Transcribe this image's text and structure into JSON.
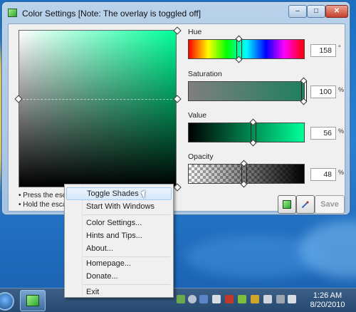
{
  "window": {
    "title": "Color Settings [Note: The overlay is toggled off]",
    "minimize": "–",
    "maximize": "□",
    "close": "✕"
  },
  "help_lines": [
    "• Press the escape",
    "• Hold the escape"
  ],
  "sliders": {
    "hue": {
      "label": "Hue",
      "value": "158",
      "unit": "°",
      "fraction": 0.44
    },
    "saturation": {
      "label": "Saturation",
      "value": "100",
      "unit": "%",
      "fraction": 1.0
    },
    "value": {
      "label": "Value",
      "value": "56",
      "unit": "%",
      "fraction": 0.56
    },
    "opacity": {
      "label": "Opacity",
      "value": "48",
      "unit": "%",
      "fraction": 0.48
    }
  },
  "buttons": {
    "save": "Save"
  },
  "icons": {
    "app": "monitor-icon",
    "toggle_overlay": "monitor-icon",
    "eyedropper": "eyedropper-icon"
  },
  "context_menu": {
    "items": [
      {
        "label": "Toggle Shades",
        "highlighted": true
      },
      {
        "label": "Start With Windows"
      },
      {
        "label": "Color Settings..."
      },
      {
        "label": "Hints and Tips..."
      },
      {
        "label": "About..."
      },
      {
        "label": "Homepage..."
      },
      {
        "label": "Donate..."
      },
      {
        "label": "Exit"
      }
    ]
  },
  "taskbar": {
    "clock_time": "1:26 AM",
    "clock_date": "8/20/2010"
  },
  "colors": {
    "selected": "#00ff99",
    "accent": "#1f7f5f"
  }
}
